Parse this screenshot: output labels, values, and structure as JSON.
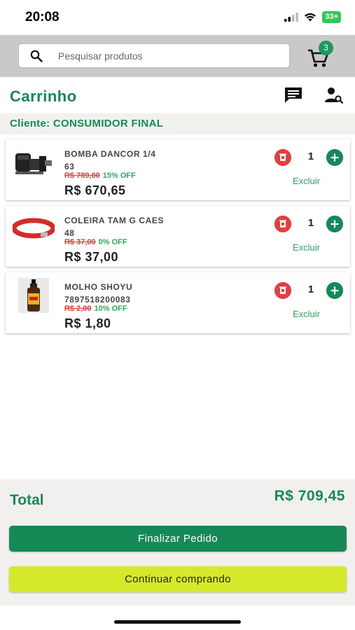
{
  "status_bar": {
    "time": "20:08",
    "battery": "33+"
  },
  "search": {
    "placeholder": "Pesquisar produtos"
  },
  "cart": {
    "badge_count": "3"
  },
  "header": {
    "title": "Carrinho"
  },
  "client": {
    "label": "Cliente: CONSUMIDOR FINAL"
  },
  "items": [
    {
      "name_line1": "BOMBA DANCOR 1/4",
      "name_line2": "63",
      "old_price": "R$ 789,00",
      "discount": "15% OFF",
      "price": "R$ 670,65",
      "qty": "1",
      "remove_label": "Excluir",
      "image_icon": "pump-icon"
    },
    {
      "name_line1": "COLEIRA TAM G CAES",
      "name_line2": "48",
      "old_price": "R$ 37,00",
      "discount": "0% OFF",
      "price": "R$ 37,00",
      "qty": "1",
      "remove_label": "Excluir",
      "image_icon": "collar-icon"
    },
    {
      "name_line1": "MOLHO SHOYU",
      "name_line2": "7897518200083",
      "old_price": "R$ 2,00",
      "discount": "10% OFF",
      "price": "R$ 1,80",
      "qty": "1",
      "remove_label": "Excluir",
      "image_icon": "bottle-icon"
    }
  ],
  "footer": {
    "total_label": "Total",
    "total_value": "R$ 709,45",
    "finalize_label": "Finalizar Pedido",
    "continue_label": "Continuar comprando"
  },
  "colors": {
    "brand_green": "#168a56",
    "accent_lime": "#d4e92a",
    "danger_red": "#e53e3e",
    "discount_green": "#2cab5e"
  }
}
